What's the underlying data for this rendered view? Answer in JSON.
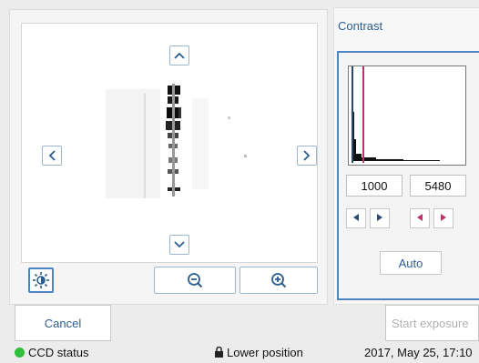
{
  "contrast": {
    "title": "Contrast",
    "min_value": "1000",
    "max_value": "5480",
    "auto_label": "Auto",
    "colors": {
      "min_marker": "#2b4a6e",
      "max_marker": "#c0306a",
      "accent": "#4a86c5"
    }
  },
  "viewer": {
    "icons": [
      "chevron-up-icon",
      "chevron-down-icon",
      "chevron-left-icon",
      "chevron-right-icon",
      "brightness-icon",
      "zoom-out-icon",
      "zoom-in-icon"
    ]
  },
  "actions": {
    "cancel_label": "Cancel",
    "start_exposure_label": "Start exposure"
  },
  "status": {
    "ccd_label": "CCD status",
    "ccd_color": "#2fbf3a",
    "position_label": "Lower position",
    "datetime": "2017, May 25, 17:10"
  }
}
